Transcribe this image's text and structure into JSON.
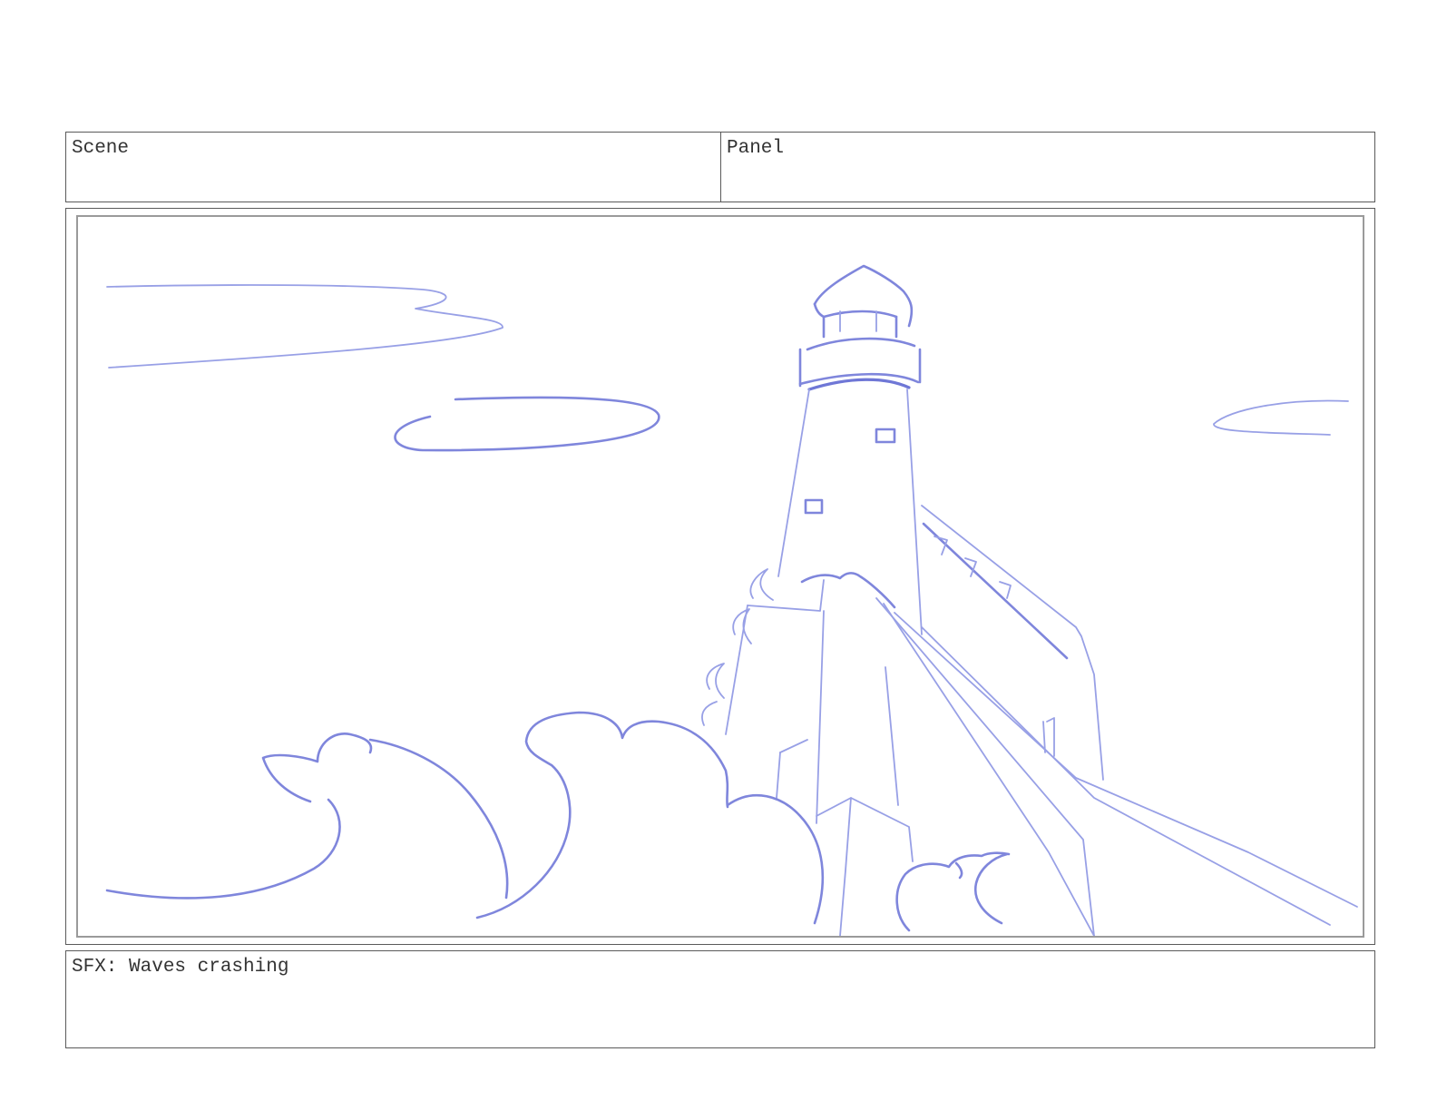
{
  "header": {
    "scene_label": "Scene",
    "panel_label": "Panel"
  },
  "frame": {
    "sketch_subject": "lighthouse-with-waves"
  },
  "notes": {
    "text": "SFX: Waves crashing"
  },
  "colors": {
    "sketch_stroke": "#7f86dc",
    "border": "#5a5a5a"
  }
}
